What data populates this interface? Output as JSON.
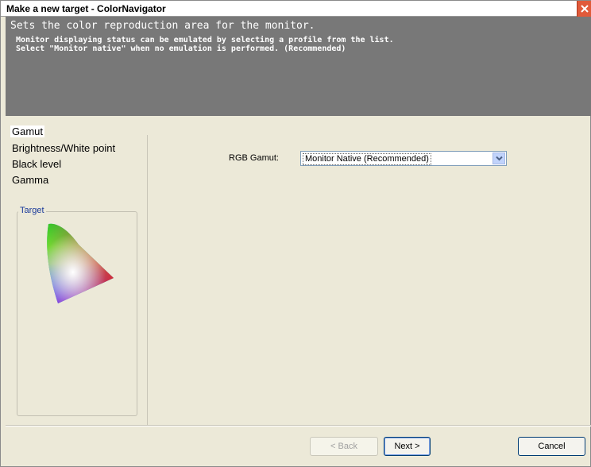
{
  "window": {
    "title": "Make a new target - ColorNavigator"
  },
  "header": {
    "title": "Sets the color reproduction area for the monitor.",
    "description": "Monitor displaying status can be emulated by selecting a profile from the list.\nSelect \"Monitor native\" when no emulation is performed. (Recommended)"
  },
  "sidebar": {
    "items": [
      {
        "label": "Gamut",
        "active": true
      },
      {
        "label": "Brightness/White point",
        "active": false
      },
      {
        "label": "Black level",
        "active": false
      },
      {
        "label": "Gamma",
        "active": false
      }
    ],
    "target_label": "Target"
  },
  "main": {
    "rgb_gamut_label": "RGB Gamut:",
    "rgb_gamut_value": "Monitor Native (Recommended)"
  },
  "buttons": {
    "back": "< Back",
    "next": "Next >",
    "cancel": "Cancel"
  },
  "icons": {
    "close": "close-icon",
    "dropdown": "chevron-down-icon",
    "gamut_diagram": "gamut-triangle-icon"
  },
  "colors": {
    "header_bg": "#787878",
    "window_bg": "#ece9d8",
    "close_bg": "#e05a3a",
    "target_label": "#1a3a9a"
  }
}
